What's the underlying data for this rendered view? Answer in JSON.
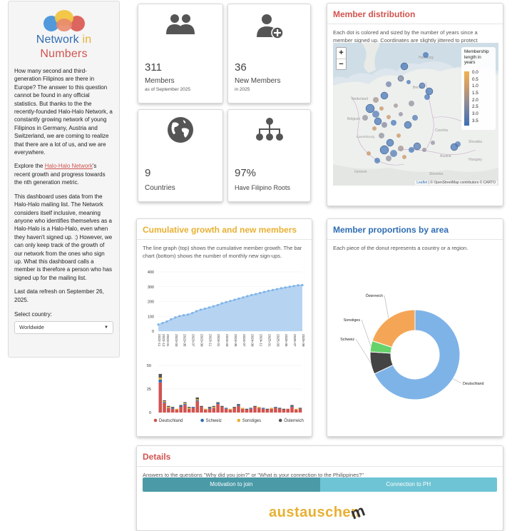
{
  "sidebar": {
    "brand": {
      "network": "Network",
      "in": "in",
      "numbers": "Numbers"
    },
    "intro": "How many second and third-generation Filipinos are there in Europe? The answer to this question cannot be found in any official statistics. But thanks to the the recently-founded Halo-Halo Network, a constantly growing network of young Filipinos in Germany, Austria and Switzerland, we are coming to realize that there are a lot of us, and we are everywhere.",
    "explore_pre": "Explore the ",
    "explore_link": "Halo-Halo Network",
    "explore_post": "'s recent growth and progress towards the nth generation metric.",
    "data_note": "This dashboard uses data from the Halo-Halo mailing list. The Network considers itself inclusive, meaning anyone who identifies themselves as a Halo-Halo is a Halo-Halo, even when they haven't signed up. :) However, we can only keep track of the growth of our network from the ones who sign up. What this dashboard calls a member is therefore a person who has signed up for the mailing list.",
    "refresh": "Last data refresh on September 26, 2025.",
    "select_label": "Select country:",
    "select_value": "Worldwide"
  },
  "stats": {
    "members": {
      "value": "311",
      "label": "Members",
      "sub": "as of September 2025",
      "icon": "users-icon"
    },
    "new_members": {
      "value": "36",
      "label": "New Members",
      "sub": "in 2025",
      "icon": "user-plus-icon"
    },
    "countries": {
      "value": "9",
      "label": "Countries",
      "icon": "globe-icon"
    },
    "roots": {
      "value": "97%",
      "label": "Have Filipino Roots",
      "icon": "family-tree-icon"
    }
  },
  "map_box": {
    "title": "Member distribution",
    "desc": "Each dot is colored and sized by the number of years since a member signed up. Coordinates are slightly jittered to protect personal data.",
    "zoom_in": "+",
    "zoom_out": "−",
    "legend_title": "Membership length in years",
    "legend_ticks": [
      "0.0",
      "0.5",
      "1.0",
      "1.5",
      "2.0",
      "2.5",
      "3.0",
      "3.5"
    ],
    "labels": [
      "Berlin",
      "Hamburg",
      "Polska",
      "Czechia",
      "Slovakia",
      "Hungary",
      "Slovenia",
      "Belgium",
      "Austria",
      "Nederland",
      "Luxembourg",
      "Geneve"
    ],
    "attribution_leaflet": "Leaflet",
    "attribution_rest": "| © OpenStreetMap contributors © CARTO",
    "colors": {
      "new": "#f1b24f",
      "old": "#3d6fb3"
    }
  },
  "growth_box": {
    "title": "Cumulative growth and new members",
    "desc": "The line graph (top) shows the cumulative member growth. The bar chart (bottom) shows the number of monthly new sign-ups."
  },
  "donut_box": {
    "title": "Member proportions by area",
    "desc": "Each piece of the donut represents a country or a region."
  },
  "details_box": {
    "title": "Details",
    "desc": "Answers to the questions \"Why did you join?\" or \"What is your connection to the Philippines?\"",
    "tab1": "Motivation to join",
    "tab2": "Connection to PH",
    "wordcloud_word": "austauschen"
  },
  "chart_data": [
    {
      "type": "area",
      "title": "",
      "x_labels": [
        "2022-11",
        "2022-12",
        "2023-01",
        "2023-02",
        "2023-03",
        "2023-04",
        "2023-05",
        "2023-06",
        "2023-07",
        "2023-08",
        "2023-09",
        "2023-10",
        "2023-11",
        "2023-12",
        "2024-01",
        "2024-02",
        "2024-03",
        "2024-04",
        "2024-05",
        "2024-06",
        "2024-07",
        "2024-08",
        "2024-09",
        "2024-10",
        "2024-11",
        "2024-12",
        "2025-01",
        "2025-02",
        "2025-03",
        "2025-04",
        "2025-05",
        "2025-06",
        "2025-07",
        "2025-08",
        "2025-09"
      ],
      "tick_labels": [
        "2022-11",
        "2022-12",
        "2023-01",
        "2023-03",
        "2023-05",
        "2023-07",
        "2023-09",
        "2023-11",
        "2024-01",
        "2024-03",
        "2024-05",
        "2024-07",
        "2024-09",
        "2024-11",
        "2025-01",
        "2025-03",
        "2025-05",
        "2025-07",
        "2025-09"
      ],
      "values": [
        45,
        55,
        65,
        80,
        92,
        102,
        108,
        112,
        122,
        135,
        145,
        152,
        160,
        168,
        176,
        188,
        196,
        204,
        212,
        220,
        228,
        236,
        244,
        250,
        258,
        265,
        272,
        278,
        284,
        290,
        295,
        300,
        305,
        310,
        311
      ],
      "ylim": [
        0,
        400
      ],
      "yticks": [
        0,
        100,
        200,
        300,
        400
      ],
      "colors": {
        "fill": "#a9cdf0",
        "line": "#7eb3e8"
      }
    },
    {
      "type": "bar",
      "title": "",
      "stacked": true,
      "categories_count": 35,
      "ylim": [
        0,
        50
      ],
      "yticks": [
        0,
        25,
        50
      ],
      "series": [
        {
          "name": "Deutschland",
          "color": "#d1534f",
          "values": [
            32,
            10,
            5,
            4,
            3,
            6,
            8,
            4,
            5,
            12,
            6,
            3,
            4,
            5,
            9,
            6,
            4,
            3,
            5,
            7,
            4,
            3,
            4,
            6,
            5,
            4,
            3,
            4,
            5,
            4,
            3,
            4,
            6,
            3,
            4
          ]
        },
        {
          "name": "Schweiz",
          "color": "#2f6db3",
          "values": [
            3,
            1,
            0,
            1,
            0,
            1,
            1,
            0,
            1,
            1,
            0,
            0,
            1,
            0,
            1,
            0,
            1,
            0,
            0,
            1,
            0,
            0,
            1,
            0,
            0,
            1,
            0,
            0,
            1,
            0,
            0,
            0,
            1,
            0,
            0
          ]
        },
        {
          "name": "Sonstiges",
          "color": "#e8b032",
          "values": [
            2,
            1,
            1,
            0,
            1,
            0,
            1,
            1,
            0,
            1,
            0,
            1,
            0,
            1,
            0,
            0,
            0,
            1,
            0,
            0,
            1,
            0,
            0,
            0,
            1,
            0,
            0,
            1,
            0,
            0,
            0,
            0,
            0,
            1,
            0
          ]
        },
        {
          "name": "Österreich",
          "color": "#555555",
          "values": [
            4,
            1,
            1,
            1,
            0,
            1,
            1,
            1,
            0,
            2,
            1,
            0,
            1,
            1,
            1,
            1,
            0,
            0,
            1,
            1,
            0,
            1,
            0,
            1,
            0,
            0,
            1,
            0,
            0,
            1,
            1,
            0,
            1,
            0,
            1
          ]
        }
      ]
    },
    {
      "type": "pie",
      "title": "",
      "donut": true,
      "labels": [
        "Deutschland",
        "Schweiz",
        "Sonstiges",
        "Österreich"
      ],
      "values": [
        68,
        8,
        4,
        20
      ],
      "colors": [
        "#7eb3e8",
        "#444444",
        "#66d26a",
        "#f4a656"
      ]
    }
  ]
}
